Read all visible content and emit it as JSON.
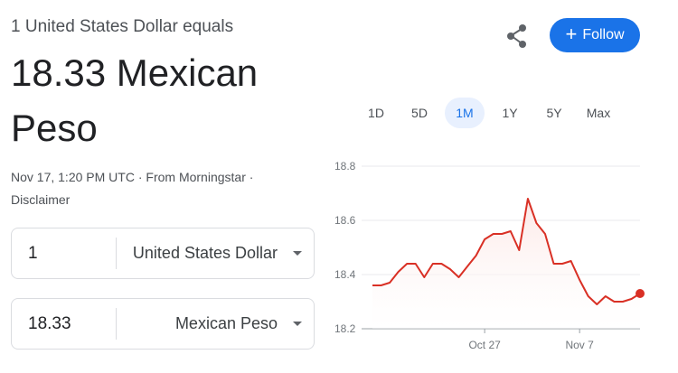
{
  "header": {
    "subtitle": "1 United States Dollar equals",
    "rate_line1": "18.33 Mexican",
    "rate_line2": "Peso",
    "timestamp": "Nov 17, 1:20 PM UTC",
    "source": "From Morningstar",
    "disclaimer": "Disclaimer",
    "separator": "·"
  },
  "actions": {
    "share_icon": "share-icon",
    "follow_label": "Follow",
    "follow_icon": "+"
  },
  "converter": {
    "from": {
      "amount": "1",
      "currency": "United States Dollar"
    },
    "to": {
      "amount": "18.33",
      "currency": "Mexican Peso"
    }
  },
  "range_tabs": [
    {
      "label": "1D"
    },
    {
      "label": "5D"
    },
    {
      "label": "1M",
      "active": true
    },
    {
      "label": "1Y"
    },
    {
      "label": "5Y"
    },
    {
      "label": "Max"
    }
  ],
  "colors": {
    "accent": "#1a73e8",
    "line": "#d93025",
    "fill": "#fce8e6"
  },
  "chart_data": {
    "type": "line",
    "y_ticks": [
      18.8,
      18.6,
      18.4,
      18.2
    ],
    "ylim": [
      18.2,
      18.8
    ],
    "x_ticks": [
      "Oct 27",
      "Nov 7"
    ],
    "x_tick_index": [
      13,
      24
    ],
    "series": [
      {
        "values": [
          18.36,
          18.36,
          18.37,
          18.41,
          18.44,
          18.44,
          18.39,
          18.44,
          18.44,
          18.42,
          18.39,
          18.43,
          18.47,
          18.53,
          18.55,
          18.55,
          18.56,
          18.49,
          18.68,
          18.59,
          18.55,
          18.44,
          18.44,
          18.45,
          18.38,
          18.32,
          18.29,
          18.32,
          18.3,
          18.3,
          18.31,
          18.33
        ]
      }
    ],
    "grid": true
  }
}
